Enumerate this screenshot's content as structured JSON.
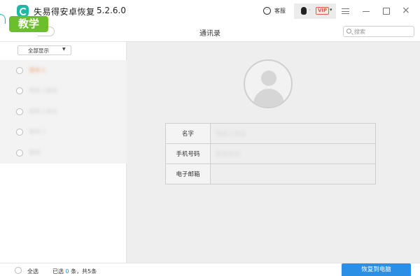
{
  "window": {
    "title": "失易得安卓恢复",
    "version": "5.2.6.0",
    "service_label": "客服",
    "service_icon": "chat-bubble-icon",
    "user_dot": "·",
    "vip_label": "VIP",
    "caret": "▾",
    "close_glyph": "×"
  },
  "watermark": {
    "label": "教学"
  },
  "header": {
    "title": "通讯录",
    "search_placeholder": "搜索"
  },
  "sidebar": {
    "filter": {
      "selected": "全部显示",
      "caret": "▼"
    },
    "contacts": [
      {
        "name": "联系人"
      },
      {
        "name": "联系人姓名"
      },
      {
        "name": "联系人姓名"
      },
      {
        "name": "联系人"
      },
      {
        "name": "联系"
      }
    ]
  },
  "detail": {
    "fields": [
      {
        "label": "名字",
        "value": "联系人姓名"
      },
      {
        "label": "手机号码",
        "value": "联系电话"
      },
      {
        "label": "电子邮箱",
        "value": ""
      }
    ]
  },
  "footer": {
    "select_all_label": "全选",
    "status_prefix": "已选",
    "selected_count": "0",
    "status_suffix": "条，共5条",
    "restore_button": "恢复到电脑"
  },
  "colors": {
    "accent": "#2b8fe6",
    "brand": "#1fb8a8",
    "watermark": "#6cbf2a",
    "vip": "#e0584f"
  }
}
